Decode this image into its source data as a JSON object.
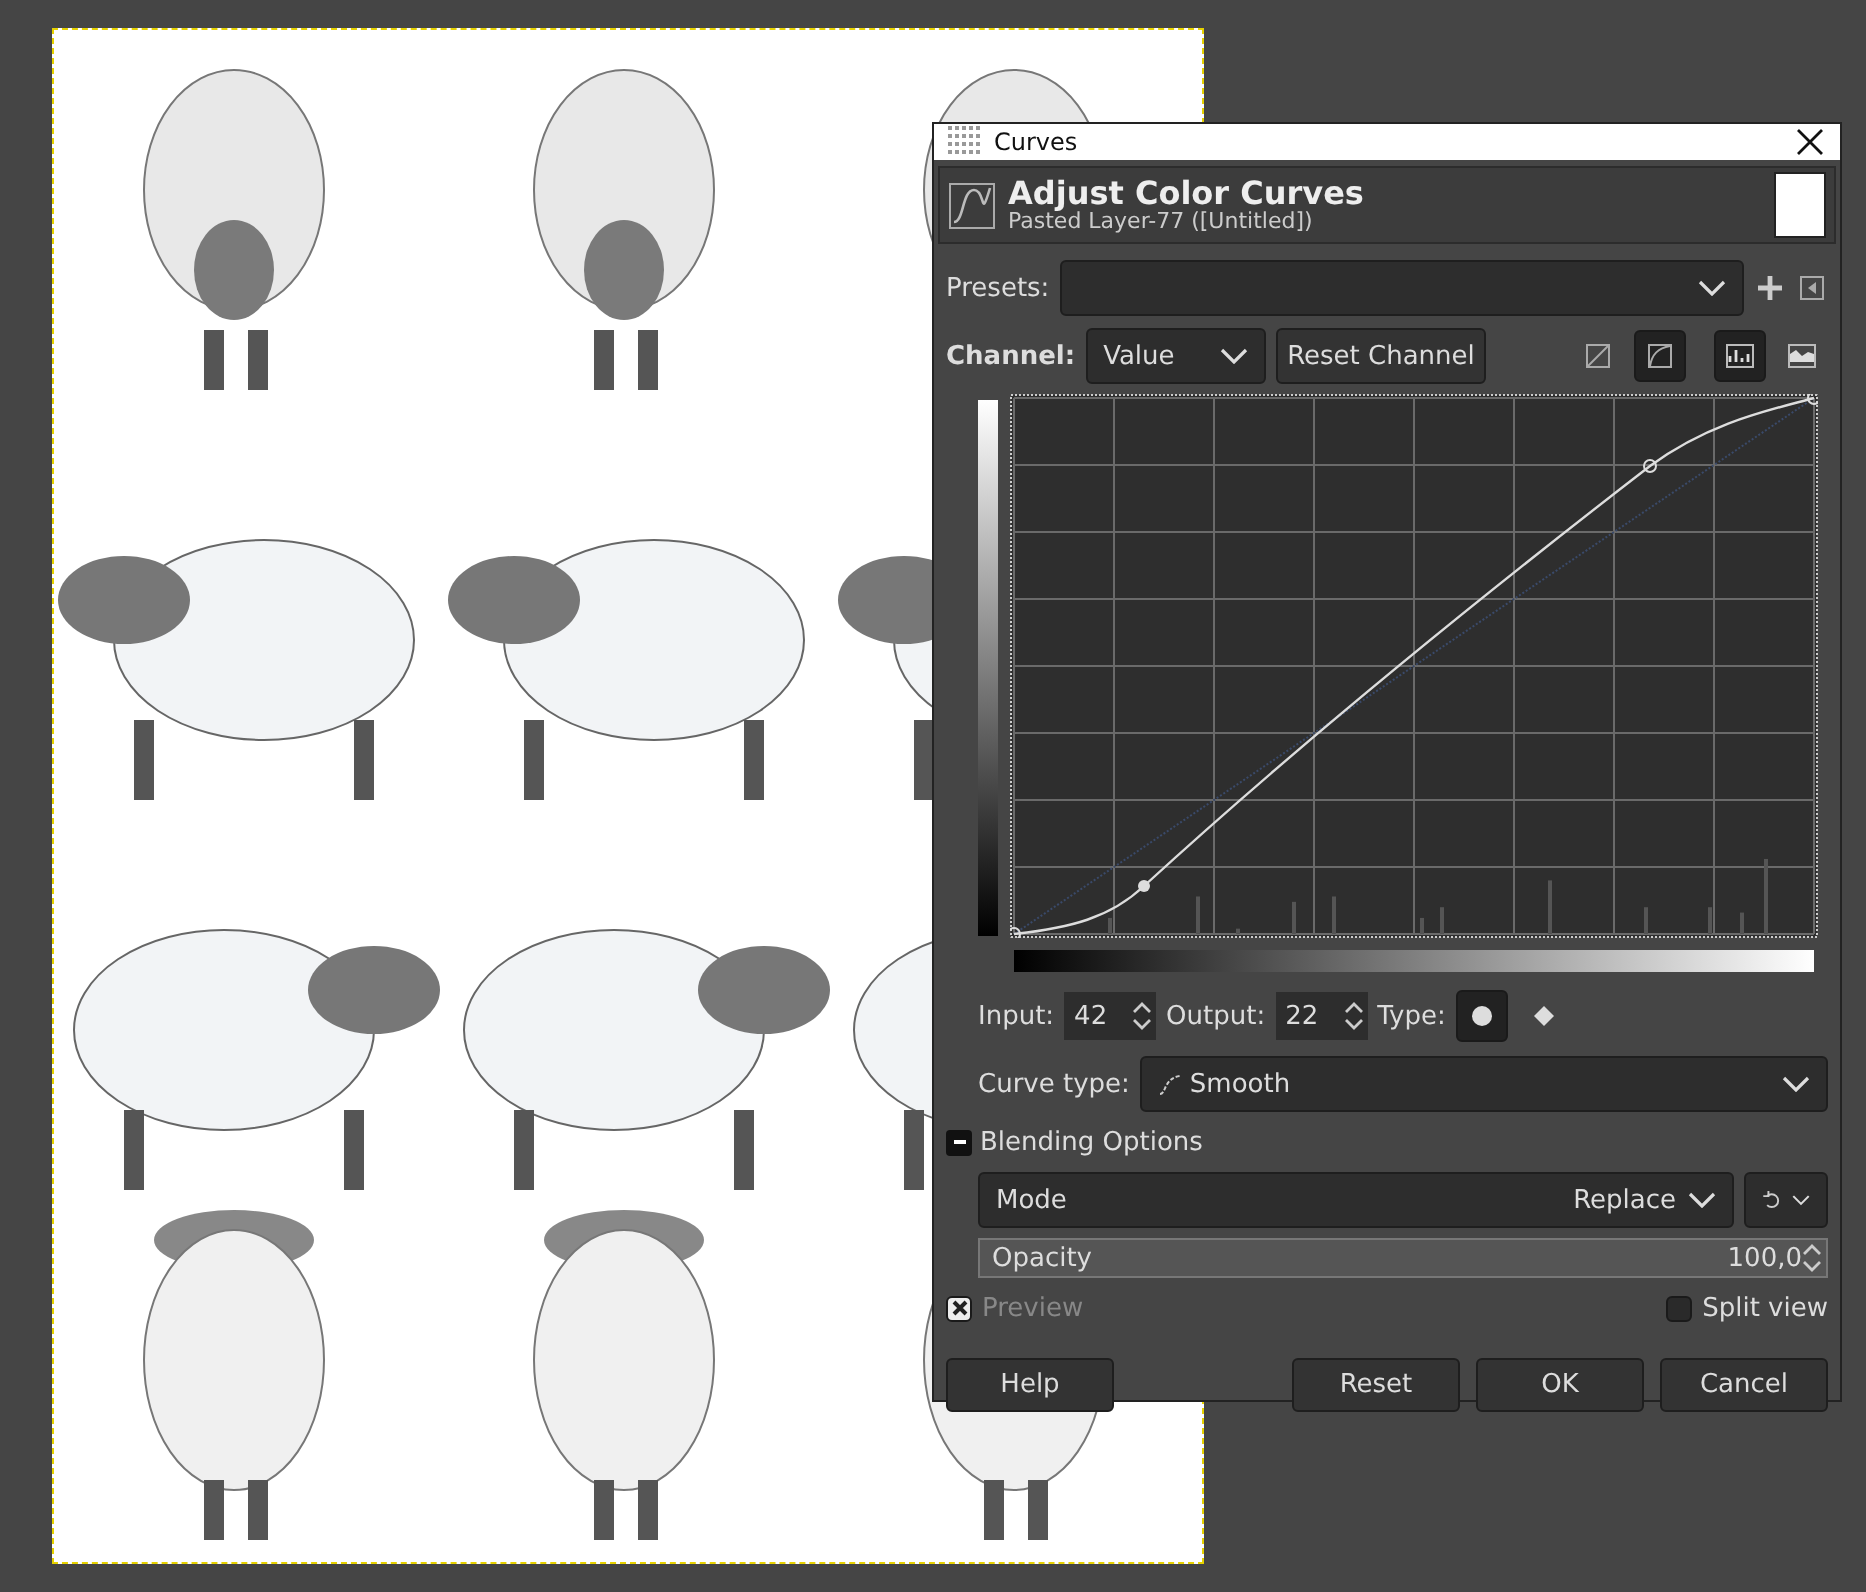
{
  "window": {
    "title": "Curves"
  },
  "header": {
    "title": "Adjust Color Curves",
    "subtitle": "Pasted Layer-77 ([Untitled])"
  },
  "presets": {
    "label": "Presets:"
  },
  "channel": {
    "label": "Channel:",
    "value": "Value",
    "reset_button": "Reset Channel"
  },
  "curve_toggles": [
    {
      "selected": false
    },
    {
      "selected": true
    }
  ],
  "histogram_toggles": [
    {
      "selected": true
    },
    {
      "selected": false
    }
  ],
  "point": {
    "input_label": "Input:",
    "input": "42",
    "output_label": "Output:",
    "output": "22",
    "type_label": "Type:"
  },
  "point_types": [
    {
      "kind": "smooth",
      "selected": true
    },
    {
      "kind": "corner",
      "selected": false
    }
  ],
  "curve_type": {
    "label": "Curve type:",
    "value": "Smooth"
  },
  "blending": {
    "label": "Blending Options",
    "expanded": true,
    "mode_label": "Mode",
    "mode": "Replace",
    "opacity_label": "Opacity",
    "opacity": "100,0",
    "level": 1
  },
  "preview": {
    "label": "Preview",
    "checked": true
  },
  "split_view": {
    "label": "Split view",
    "checked": false
  },
  "buttons": {
    "help": "Help",
    "reset": "Reset",
    "ok": "OK",
    "cancel": "Cancel"
  }
}
